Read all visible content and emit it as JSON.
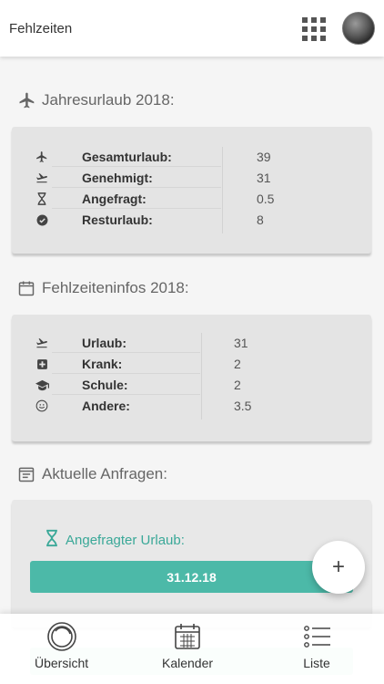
{
  "header": {
    "title": "Fehlzeiten",
    "apps_icon": "grid-icon",
    "avatar_icon": "avatar"
  },
  "annual_leave": {
    "title": "Jahresurlaub 2018:",
    "icon": "airplane-icon",
    "rows": [
      {
        "icon": "airplane-icon",
        "label": "Gesamturlaub:",
        "value": "39"
      },
      {
        "icon": "plane-departure-icon",
        "label": "Genehmigt:",
        "value": "31"
      },
      {
        "icon": "hourglass-icon",
        "label": "Angefragt:",
        "value": "0.5"
      },
      {
        "icon": "check-circle-icon",
        "label": "Resturlaub:",
        "value": "8"
      }
    ]
  },
  "absence_info": {
    "title": "Fehlzeiteninfos 2018:",
    "icon": "calendar-icon",
    "rows": [
      {
        "icon": "plane-departure-icon",
        "label": "Urlaub:",
        "value": "31"
      },
      {
        "icon": "medical-plus-icon",
        "label": "Krank:",
        "value": "2"
      },
      {
        "icon": "graduation-cap-icon",
        "label": "Schule:",
        "value": "2"
      },
      {
        "icon": "smiley-icon",
        "label": "Andere:",
        "value": "3.5"
      }
    ]
  },
  "requests": {
    "title": "Aktuelle Anfragen:",
    "icon": "list-calendar-icon",
    "pending_label": "Angefragter Urlaub:",
    "pending_date": "31.12.18",
    "accent": "#4cb9a8"
  },
  "fab": {
    "label": "+"
  },
  "nav": {
    "items": [
      {
        "label": "Übersicht",
        "icon": "overview-icon"
      },
      {
        "label": "Kalender",
        "icon": "calendar-icon"
      },
      {
        "label": "Liste",
        "icon": "list-icon"
      }
    ]
  }
}
